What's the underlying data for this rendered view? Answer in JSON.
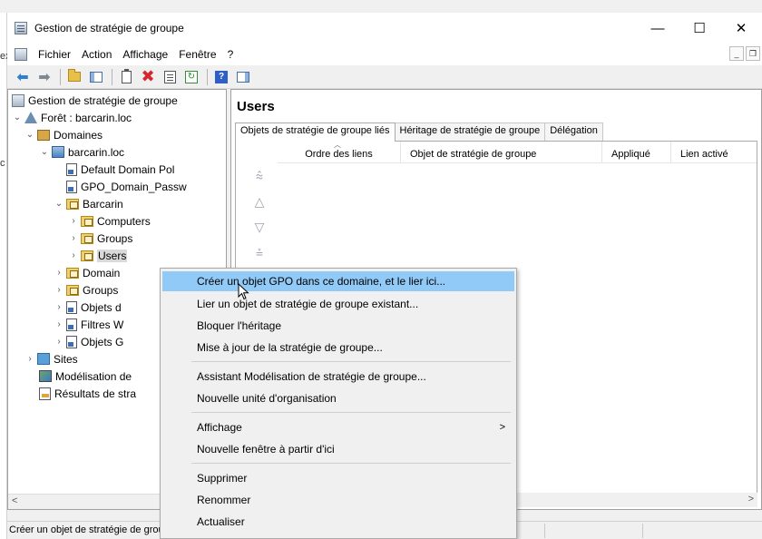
{
  "background": {
    "fragments_left": [
      "ex",
      "c"
    ]
  },
  "window": {
    "title": "Gestion de stratégie de groupe",
    "controls": {
      "minimize": "—",
      "maximize": "☐",
      "close": "✕"
    }
  },
  "menubar": {
    "items": [
      "Fichier",
      "Action",
      "Affichage",
      "Fenêtre",
      "?"
    ]
  },
  "tree": {
    "root": "Gestion de stratégie de groupe",
    "forest": "Forêt : barcarin.loc",
    "domains": "Domaines",
    "domain": "barcarin.loc",
    "gpo1": "Default Domain Pol",
    "gpo2": "GPO_Domain_Passw",
    "ou_barcarin": "Barcarin",
    "ou_computers": "Computers",
    "ou_groups": "Groups",
    "ou_users": "Users",
    "domain_ctrl": "Domain",
    "groups2": "Groups",
    "objets_d": "Objets d",
    "filtres": "Filtres W",
    "objets_g": "Objets G",
    "sites": "Sites",
    "modelisation": "Modélisation de",
    "resultats": "Résultats de stra",
    "hscroll_left": "<"
  },
  "right_pane": {
    "title": "Users",
    "tabs": [
      "Objets de stratégie de groupe liés",
      "Héritage de stratégie de groupe",
      "Délégation"
    ],
    "columns": [
      "Ordre des liens",
      "Objet de stratégie de groupe",
      "Appliqué",
      "Lien activé"
    ],
    "arrows": [
      "⩯",
      "△",
      "▽",
      "⩮"
    ],
    "hscroll_right": ">"
  },
  "statusbar": {
    "text": "Créer un objet de stratégie de groupe"
  },
  "context_menu": {
    "items": [
      "Créer un objet GPO dans ce domaine, et le lier ici...",
      "Lier un objet de stratégie de groupe existant...",
      "Bloquer l'héritage",
      "Mise à jour de la stratégie de groupe...",
      "Assistant Modélisation de stratégie de groupe...",
      "Nouvelle unité d'organisation",
      "Affichage",
      "Nouvelle fenêtre à partir d'ici",
      "Supprimer",
      "Renommer",
      "Actualiser"
    ],
    "submenu_arrow": ">",
    "highlight_color": "#91c9f7"
  }
}
